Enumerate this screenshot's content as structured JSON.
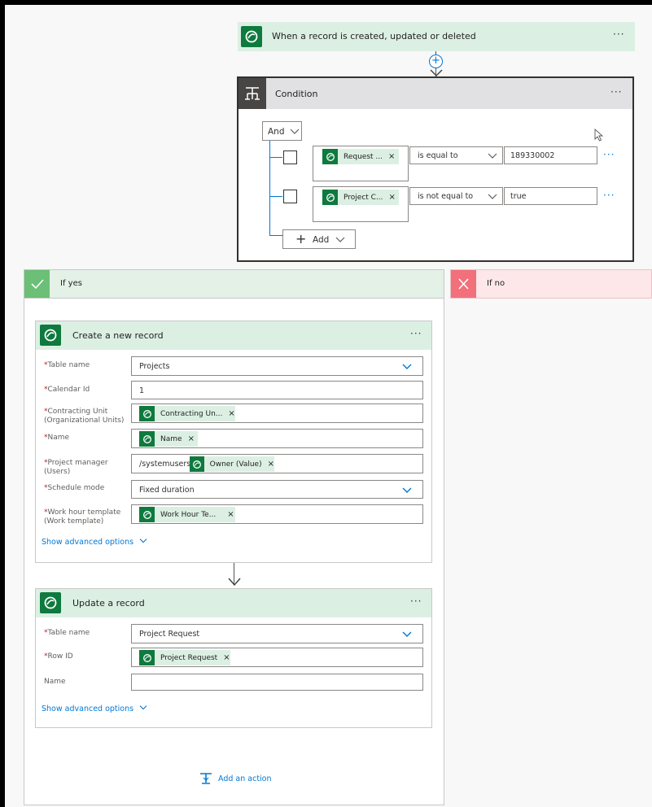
{
  "trigger": {
    "title": "When a record is created, updated or deleted",
    "menu": "···"
  },
  "condition": {
    "title": "Condition",
    "menu": "···",
    "group_operator": "And",
    "rows": [
      {
        "left_token": "Request ...",
        "operator": "is equal to",
        "value": "189330002",
        "menu": "···"
      },
      {
        "left_token": "Project C...",
        "operator": "is not equal to",
        "value": "true",
        "menu": "···"
      }
    ],
    "add_label": "Add"
  },
  "branch_yes": {
    "title": "If yes"
  },
  "branch_no": {
    "title": "If no"
  },
  "create_record": {
    "title": "Create a new record",
    "menu": "···",
    "fields": [
      {
        "label": "Table name",
        "value": "Projects"
      },
      {
        "label": "Calendar Id",
        "value": "1"
      },
      {
        "label": "Contracting Unit",
        "sublabel": "(Organizational Units)",
        "token": "Contracting Un..."
      },
      {
        "label": "Name",
        "token": "Name"
      },
      {
        "label": "Project manager",
        "sublabel": "(Users)",
        "prefix": "/systemusers/",
        "token": "Owner (Value)"
      },
      {
        "label": "Schedule mode",
        "value": "Fixed duration"
      },
      {
        "label": "Work hour template",
        "sublabel": "(Work template)",
        "token": "Work Hour Te..."
      }
    ],
    "show_advanced": "Show advanced options"
  },
  "update_record": {
    "title": "Update a record",
    "menu": "···",
    "fields": [
      {
        "label": "Table name",
        "value": "Project Request"
      },
      {
        "label": "Row ID",
        "token": "Project Request"
      },
      {
        "label": "Name",
        "value": ""
      }
    ],
    "show_advanced": "Show advanced options"
  },
  "add_action": "Add an action",
  "token_close": "×",
  "required_mark": "*",
  "colors": {
    "dataverse_green": "#0e7a3e",
    "header_green": "#dcefe3",
    "yes_green": "#e3f1e7",
    "no_red": "#fde7e9",
    "link_blue": "#0078d4"
  }
}
